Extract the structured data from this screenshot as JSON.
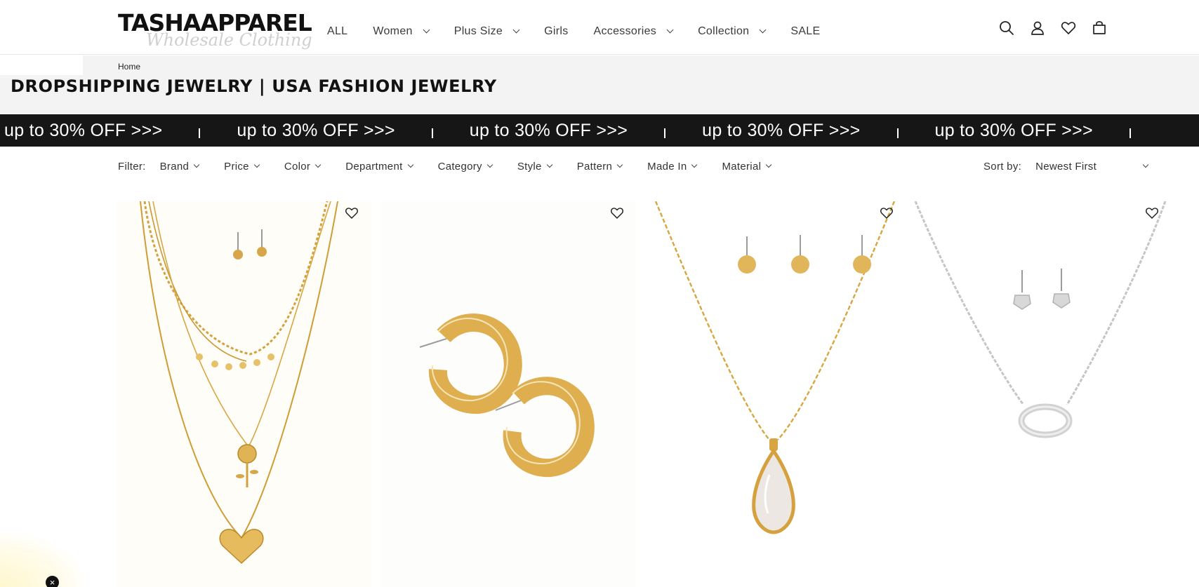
{
  "brand": {
    "name": "TASHAAPPAREL",
    "tagline": "Wholesale Clothing"
  },
  "nav": {
    "items": [
      {
        "label": "ALL",
        "dropdown": false
      },
      {
        "label": "Women",
        "dropdown": true
      },
      {
        "label": "Plus Size",
        "dropdown": true
      },
      {
        "label": "Girls",
        "dropdown": false
      },
      {
        "label": "Accessories",
        "dropdown": true
      },
      {
        "label": "Collection",
        "dropdown": true
      },
      {
        "label": "SALE",
        "dropdown": false
      }
    ]
  },
  "header_icons": [
    "search-icon",
    "account-icon",
    "wishlist-icon",
    "cart-icon"
  ],
  "breadcrumb": {
    "home": "Home"
  },
  "page": {
    "title": "DROPSHIPPING JEWELRY | USA FASHION JEWELRY"
  },
  "promo": {
    "text": "up to 30% OFF >>>",
    "repeat_count": 5
  },
  "filters": {
    "label": "Filter:",
    "items": [
      "Brand",
      "Price",
      "Color",
      "Department",
      "Category",
      "Style",
      "Pattern",
      "Made In",
      "Material"
    ]
  },
  "sort": {
    "label": "Sort by:",
    "selected": "Newest First"
  },
  "products": [
    {
      "name": "layered gold necklace with stud earrings",
      "wishlist_icon": "heart-outline-icon"
    },
    {
      "name": "gold hoop earrings",
      "wishlist_icon": "heart-outline-icon"
    },
    {
      "name": "gold teardrop pendant necklace with stud earrings",
      "wishlist_icon": "heart-outline-icon"
    },
    {
      "name": "silver oval pendant necklace with stud earrings",
      "wishlist_icon": "heart-outline-icon"
    }
  ],
  "popup": {
    "close_label": "×"
  },
  "colors": {
    "promo_bg": "#161616",
    "title_band": "#f3f3f3",
    "gold": "#d9a93f",
    "silver": "#c8c8c8"
  }
}
